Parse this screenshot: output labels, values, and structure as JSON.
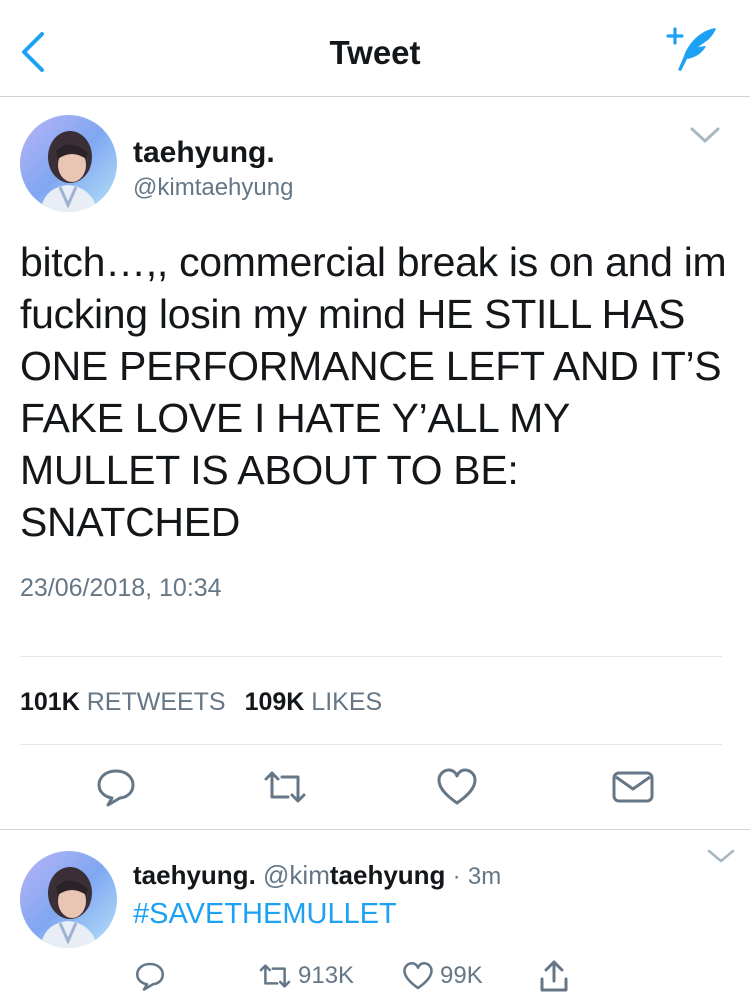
{
  "header": {
    "title": "Tweet",
    "back_icon": "chevron-left-icon",
    "compose_icon": "compose-feather-icon",
    "accent_color": "#1da1f2"
  },
  "tweet": {
    "author_name": "taehyung.",
    "author_handle": "@kimtaehyung",
    "text": "bitch…,, commercial break is on and im fucking losin my mind HE STILL HAS ONE PERFORMANCE LEFT AND IT’S FAKE LOVE I HATE Y’ALL MY MULLET IS ABOUT TO BE: SNATCHED",
    "timestamp": "23/06/2018, 10:34",
    "retweets_count": "101K",
    "retweets_label": "RETWEETS",
    "likes_count": "109K",
    "likes_label": "LIKES",
    "actions": [
      "reply-icon",
      "retweet-icon",
      "like-icon",
      "message-icon"
    ]
  },
  "reply": {
    "author_name": "taehyung.",
    "handle_prefix": "@kim",
    "handle_match": "taehyung",
    "dot": "·",
    "time": "3m",
    "text": "#SAVETHEMULLET",
    "retweets": "913K",
    "likes": "99K"
  }
}
